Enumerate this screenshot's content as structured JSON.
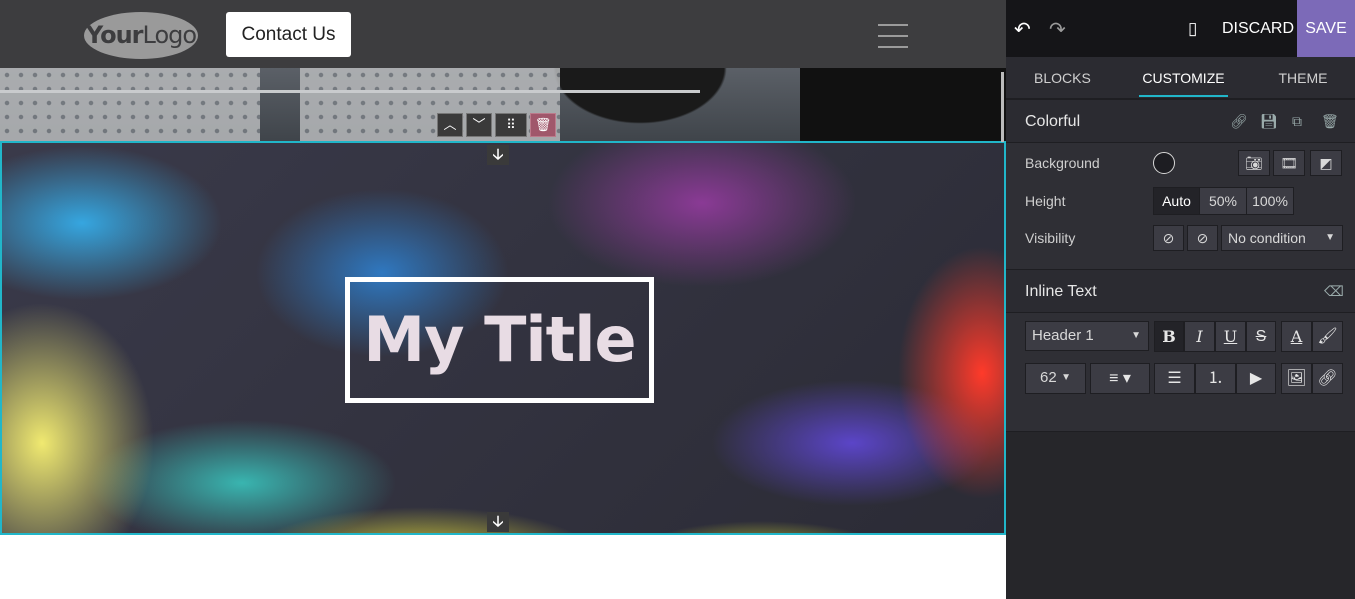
{
  "site": {
    "logo": {
      "part1": "Your",
      "part2": "Logo"
    },
    "contact_label": "Contact Us",
    "hero_title": "My Title"
  },
  "block_toolbar": [
    "chevron-up-icon",
    "chevron-down-icon",
    "grid-icon",
    "trash-icon"
  ],
  "editor": {
    "toolbar": {
      "undo_icon": "undo-icon",
      "redo_icon": "redo-icon",
      "mobile_icon": "mobile-icon",
      "discard_label": "DISCARD",
      "save_label": "SAVE"
    },
    "tabs": [
      {
        "label": "BLOCKS"
      },
      {
        "label": "CUSTOMIZE",
        "active": true
      },
      {
        "label": "THEME"
      }
    ],
    "colorful": {
      "title": "Colorful",
      "background_label": "Background",
      "height_label": "Height",
      "height_options": [
        "Auto",
        "50%",
        "100%"
      ],
      "height_selected": "Auto",
      "visibility_label": "Visibility",
      "visibility_value": "No condition"
    },
    "inline_text": {
      "title": "Inline Text",
      "style_value": "Header 1",
      "size_value": "62",
      "format_buttons": [
        "B",
        "I",
        "U",
        "S"
      ]
    }
  },
  "colors": {
    "accent": "#21b6c9",
    "save_bg": "#7c6ab8",
    "panel_bg": "#2f2f35",
    "header_bg": "#3d3d3f"
  }
}
